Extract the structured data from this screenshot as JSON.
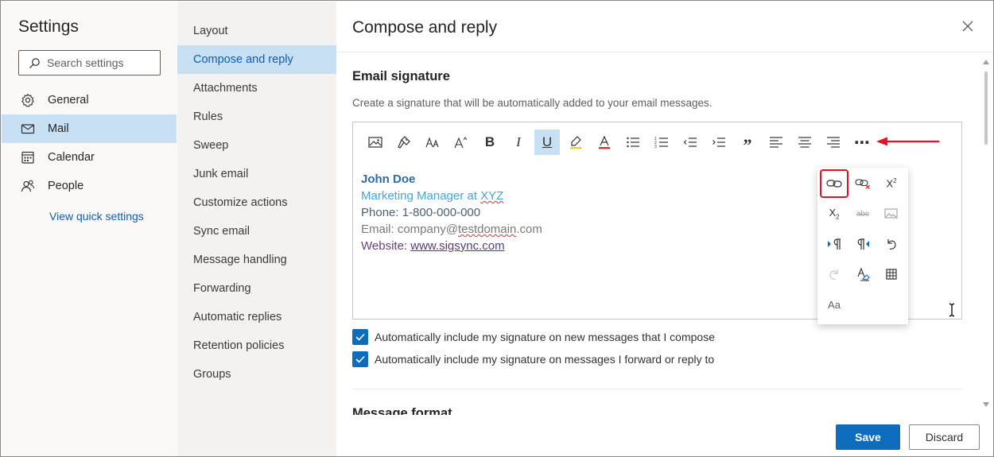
{
  "nav": {
    "title": "Settings",
    "search_placeholder": "Search settings",
    "items": [
      {
        "label": "General",
        "icon": "gear-icon"
      },
      {
        "label": "Mail",
        "icon": "mail-icon"
      },
      {
        "label": "Calendar",
        "icon": "calendar-icon"
      },
      {
        "label": "People",
        "icon": "people-icon"
      }
    ],
    "quick_settings": "View quick settings"
  },
  "sub": {
    "items": [
      "Layout",
      "Compose and reply",
      "Attachments",
      "Rules",
      "Sweep",
      "Junk email",
      "Customize actions",
      "Sync email",
      "Message handling",
      "Forwarding",
      "Automatic replies",
      "Retention policies",
      "Groups"
    ],
    "active": "Compose and reply"
  },
  "panel": {
    "title": "Compose and reply",
    "section_title": "Email signature",
    "section_desc": "Create a signature that will be automatically added to your email messages.",
    "signature": {
      "name": "John Doe",
      "role": "Marketing Manager at XYZ",
      "phone": "Phone: 1-800-000-000",
      "email": "Email: company@testdomain.com",
      "website_label": "Website: ",
      "website_link": "www.sigsync.com"
    },
    "checkbox_new": "Automatically include my signature on new messages that I compose",
    "checkbox_reply": "Automatically include my signature on messages I forward or reply to",
    "next_section": "Message format",
    "save": "Save",
    "discard": "Discard"
  },
  "toolbar": {
    "bold": "B",
    "italic": "I",
    "underline": "U",
    "quote": "”",
    "more": "⋯"
  },
  "popup": {
    "font_size_label": "Aa"
  },
  "colors": {
    "accent": "#0f6cbd",
    "selected_bg": "#c7e0f4",
    "highlight_red": "#e81123"
  }
}
